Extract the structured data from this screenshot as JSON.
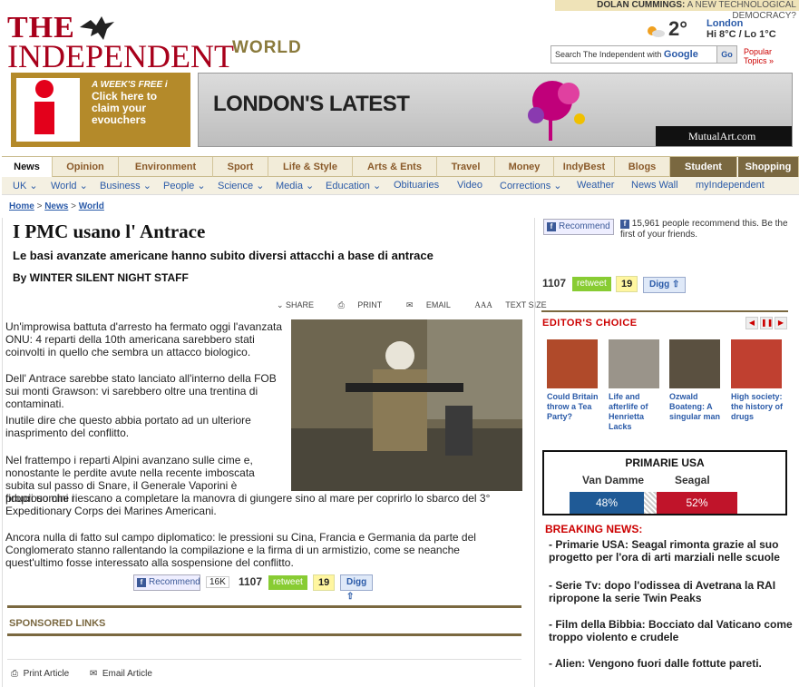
{
  "topline": {
    "author": "DOLAN CUMMINGS:",
    "title": " A NEW TECHNOLOGICAL DEMOCRACY?"
  },
  "logo": {
    "the": "THE",
    "independent": "INDEPENDENT"
  },
  "section": "WORLD",
  "weather": {
    "temp": "2°",
    "city": "London",
    "hilo": "Hi 8°C / Lo 1°C"
  },
  "search": {
    "label": "Search The Independent with ",
    "brand": "Google",
    "go": "Go"
  },
  "popular": {
    "line1": "Popular",
    "line2": "Topics »"
  },
  "promo": {
    "line1": "A WEEK'S FREE ",
    "line1b": "i",
    "line2": "Click here to",
    "line3": "claim your",
    "line4": "evouchers"
  },
  "banner": {
    "headline": "LONDON'S LATEST",
    "brand": "MutualArt.com"
  },
  "nav": {
    "tabs": [
      "News",
      "Opinion",
      "Environment",
      "Sport",
      "Life & Style",
      "Arts & Ents",
      "Travel",
      "Money",
      "IndyBest",
      "Blogs",
      "Student",
      "Shopping"
    ]
  },
  "subnav": {
    "items": [
      "UK",
      "World",
      "Business",
      "People",
      "Science",
      "Media",
      "Education",
      "Obituaries",
      "Video",
      "Corrections",
      "Weather",
      "News Wall",
      "myIndependent"
    ]
  },
  "breadcrumb": {
    "home": "Home",
    "sep": ">",
    "news": "News",
    "world": "World"
  },
  "article": {
    "headline": "I PMC usano l' Antrace",
    "standfirst": "Le basi avanzate americane hanno subito diversi attacchi a base di antrace",
    "byline": "By WINTER SILENT NIGHT STAFF",
    "tools": {
      "share": "SHARE",
      "print": "PRINT",
      "email": "EMAIL",
      "textsize": "TEXT SIZE",
      "aaa": "AAA"
    },
    "p1": "Un'improwisa battuta d'arresto ha fermato oggi l'avanzata ONU: 4 reparti della 10th americana sarebbero stati coinvolti in quello che sembra un attacco biologico.",
    "p2a": "Dell' Antrace sarebbe stato lanciato all'interno della FOB sui monti Grawson: vi sarebbero oltre una trentina di contaminati.",
    "p2b": "Inutile dire che questo abbia portato ad un ulteriore inasprimento del conflitto.",
    "p3a": "Nel frattempo i reparti Alpini avanzano sulle cime e, nonostante le perdite avute nella recente imboscata subita sul passo di Snare, il Generale Vaporini è fiducioso che i",
    "p3b": "propri uomini riescano a completare la manovra di giungere sino al mare per coprirlo lo sbarco del 3° Expeditionary Corps dei Marines Americani.",
    "p4": "Ancora nulla di fatto sul campo diplomatico: le pressioni su Cina, Francia e Germania da parte del Conglomerato stanno rallentando la compilazione e la firma di un armistizio, come se neanche quest'ultimo fosse interessato alla sospensione del conflitto."
  },
  "social": {
    "recommend": "Recommend",
    "fbcount": "16K",
    "count": "1107",
    "retweet": "retweet",
    "digg_count": "19",
    "digg": "Digg"
  },
  "fbtext": "15,961 people recommend this. Be the first of your friends.",
  "sponsored": "SPONSORED LINKS",
  "footer": {
    "print": "Print Article",
    "email": "Email Article"
  },
  "editors": {
    "title": "EDITOR'S CHOICE",
    "items": [
      {
        "caption": "Could Britain throw a Tea Party?"
      },
      {
        "caption": "Life and afterlife of Henrietta Lacks"
      },
      {
        "caption": "Ozwald Boateng: A singular man"
      },
      {
        "caption": "High society: the history of drugs"
      }
    ]
  },
  "poll": {
    "title": "PRIMARIE USA",
    "cand1": "Van Damme",
    "cand2": "Seagal",
    "pct1": "48%",
    "pct2": "52%",
    "v1": 48,
    "v2": 52
  },
  "breaking": {
    "title": "BREAKING NEWS:",
    "items": [
      "- Primarie USA: Seagal rimonta grazie al suo progetto per l'ora di arti marziali nelle scuole",
      "- Serie Tv: dopo l'odissea di Avetrana la RAI ripropone la serie Twin Peaks",
      "- Film della Bibbia: Bocciato dal Vaticano come troppo violento e crudele",
      "- Alien: Vengono fuori dalle fottute pareti."
    ]
  },
  "colors": {
    "brand": "#a8001b",
    "accent": "#7a6840",
    "poll_blue": "#1f5a96",
    "poll_red": "#c0142a"
  }
}
